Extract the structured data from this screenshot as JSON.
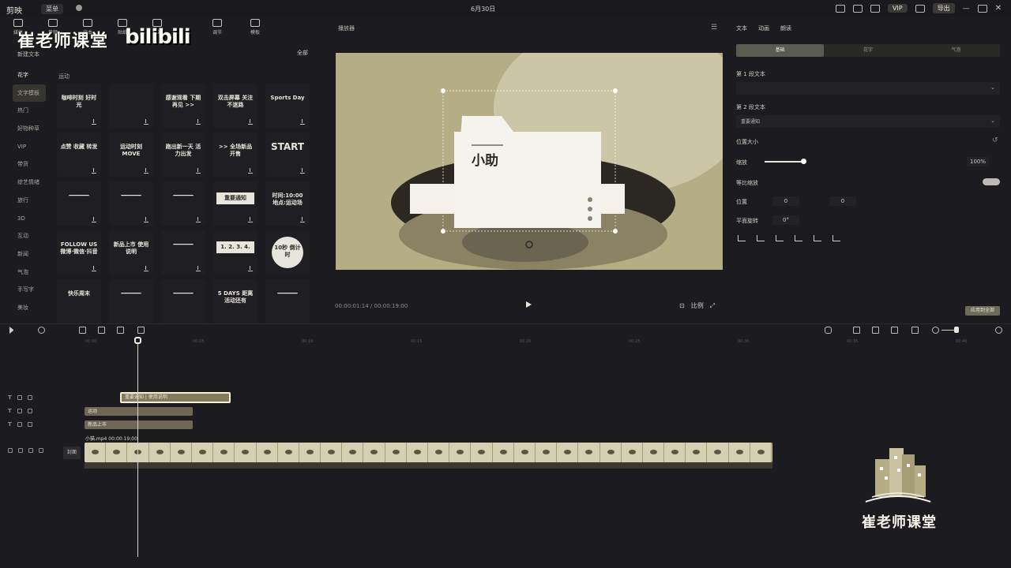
{
  "titlebar": {
    "app": "剪映",
    "menu": "菜单",
    "center_title": "6月30日",
    "vip_label": "VIP",
    "export_label": "导出"
  },
  "toolbar": {
    "left_tools": [
      "媒体",
      "音频",
      "文本",
      "贴纸",
      "特效"
    ],
    "right_tools": [
      "调节",
      "模板"
    ]
  },
  "brand": {
    "name": "崔老师课堂",
    "bili": "bilibili"
  },
  "library": {
    "new_text": "新建文本",
    "filter": "全部",
    "section": "运动",
    "categories": [
      "花字",
      "文字模板",
      "热门",
      "好物种草",
      "VIP",
      "带货",
      "综艺情绪",
      "旅行",
      "3D",
      "互动",
      "新闻",
      "气泡",
      "手写字",
      "美妆"
    ],
    "templates": [
      "咖啡时刻 好时光",
      "",
      "感谢观看 下期再见 >>",
      "双击屏幕 关注不迷路",
      "Sports Day",
      "点赞 收藏 转发",
      "运动时刻 MOVE",
      "跑出新一天 活力出发",
      ">> 全场新品开售",
      "START",
      "━━━━━━",
      "━━━━━━",
      "━━━━━━",
      "重要通知",
      "时间:10:00 地点:运动场",
      "FOLLOW US 微博·微信·抖音",
      "新品上市 使用说明",
      "━━━━━━",
      "1. 2. 3. 4.",
      "10秒 倒计时",
      "快乐周末",
      "━━━━━━",
      "━━━━━━",
      "5 DAYS 距离活动还有",
      "━━━━━━"
    ]
  },
  "player": {
    "label": "播放器",
    "overlay_text": "小助",
    "timecode": "00:00:01:14 / 00:00:19:00",
    "ratio": "比例"
  },
  "inspector": {
    "tabs": [
      "文本",
      "动画",
      "朗读"
    ],
    "subtabs": [
      "基础",
      "花字",
      "气泡"
    ],
    "para1_label": "第 1 段文本",
    "para2_label": "第 2 段文本",
    "para2_value": "重要通知",
    "pos_size": "位置大小",
    "scale_label": "缩放",
    "scale_value": "100%",
    "uniform_label": "等比缩放",
    "position_label": "位置",
    "pos_x": "0",
    "pos_y": "0",
    "rotate_label": "平面旋转",
    "rotate_value": "0°",
    "apply_all": "应用到全部"
  },
  "timeline": {
    "ruler": [
      "00:00",
      "00:05",
      "00:10",
      "00:15",
      "00:20",
      "00:25",
      "00:30",
      "00:35",
      "00:40"
    ],
    "clips": {
      "selected": "重要通知 | 使用说明",
      "text1": "运动",
      "text2": "新品上市",
      "video": "小猫.mp4  00:00:19:00",
      "cover": "封面"
    }
  },
  "watermark": {
    "name": "崔老师课堂"
  }
}
